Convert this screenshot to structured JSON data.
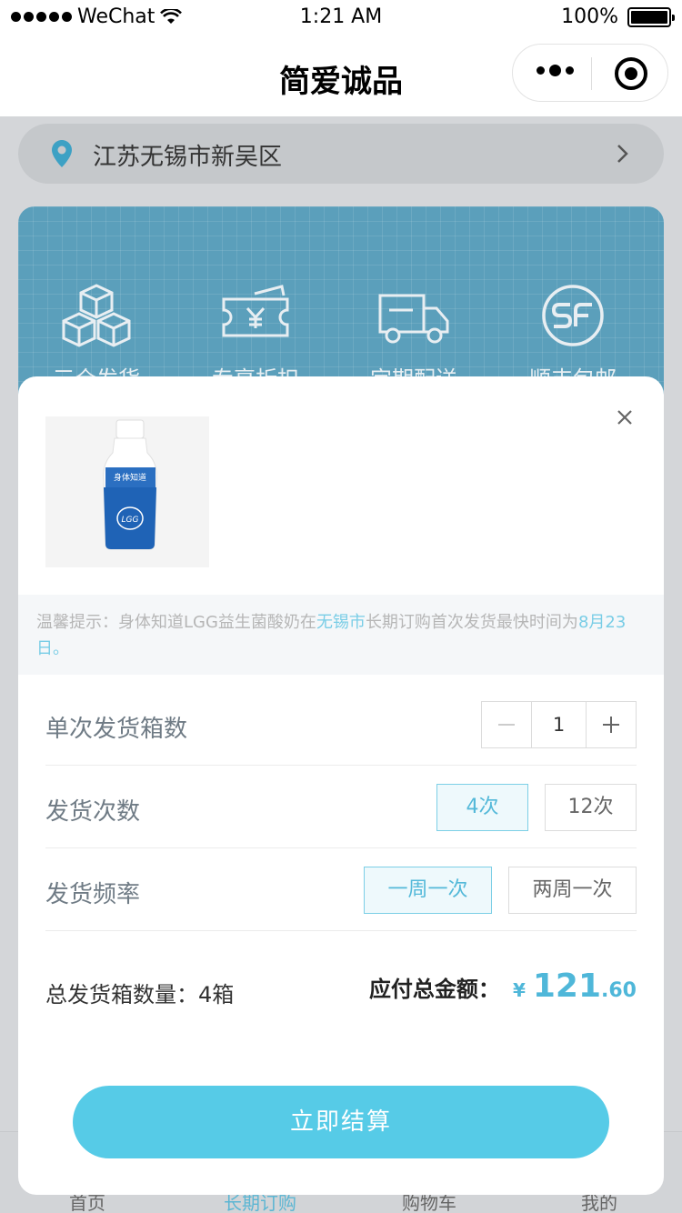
{
  "status_bar": {
    "carrier": "WeChat",
    "time": "1:21 AM",
    "battery": "100%"
  },
  "nav": {
    "title": "简爱诚品"
  },
  "location": {
    "text": "江苏无锡市新吴区"
  },
  "features": [
    {
      "label": "三仓发货",
      "icon": "boxes-icon"
    },
    {
      "label": "专享折扣",
      "icon": "ticket-icon"
    },
    {
      "label": "定期配送",
      "icon": "truck-icon"
    },
    {
      "label": "顺丰包邮",
      "icon": "sf-express-icon"
    }
  ],
  "tabbar": {
    "items": [
      "首页",
      "长期订购",
      "购物车",
      "我的"
    ]
  },
  "modal": {
    "product_image_text": "身体知道",
    "tip": {
      "prefix": "温馨提示：身体知道LGG益生菌酸奶在",
      "city": "无锡市",
      "middle": "长期订购首次发货最快时间为",
      "date": "8月23日。"
    },
    "rows": {
      "boxes_label": "单次发货箱数",
      "quantity": "1",
      "times_label": "发货次数",
      "times_options": [
        "4次",
        "12次"
      ],
      "freq_label": "发货频率",
      "freq_options": [
        "一周一次",
        "两周一次"
      ]
    },
    "summary": {
      "total_boxes": "总发货箱数量：4箱",
      "pay_label": "应付总金额：",
      "currency": "¥",
      "amount_int": "121",
      "amount_dec": ".60"
    },
    "checkout": "立即结算"
  },
  "colors": {
    "accent": "#56cbe7",
    "banner": "#5b9fbb",
    "selected_bg": "#eef9fc"
  }
}
